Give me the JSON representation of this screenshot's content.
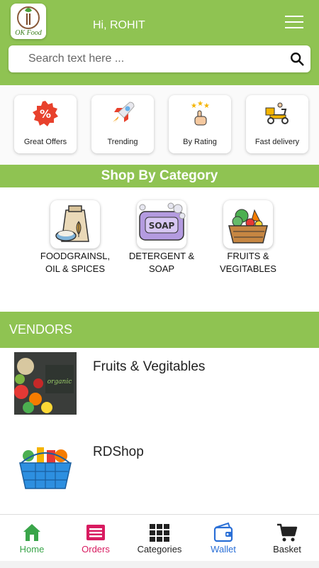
{
  "header": {
    "logo_text": "OK Food",
    "greeting": "Hi, ROHIT",
    "menu_icon": "hamburger-menu-icon"
  },
  "search": {
    "placeholder": "Search text here ...",
    "icon": "search-icon"
  },
  "quick_actions": [
    {
      "label": "Great Offers",
      "icon": "offer-percent-badge-icon"
    },
    {
      "label": "Trending",
      "icon": "rocket-icon"
    },
    {
      "label": "By Rating",
      "icon": "star-rating-hand-icon"
    },
    {
      "label": "Fast delivery",
      "icon": "delivery-scooter-icon"
    }
  ],
  "categories_section": {
    "title": "Shop By Category",
    "items": [
      {
        "label_line1": "FOODGRAINSL,",
        "label_line2": "OIL & SPICES",
        "icon": "grain-sack-icon"
      },
      {
        "label_line1": "DETERGENT &",
        "label_line2": "SOAP",
        "icon": "soap-bar-icon"
      },
      {
        "label_line1": "FRUITS &",
        "label_line2": "VEGITABLES",
        "icon": "vegetable-basket-icon"
      }
    ]
  },
  "vendors_section": {
    "title": "VENDORS",
    "items": [
      {
        "name": "Fruits & Vegitables",
        "image": "organic-vegetables-image"
      },
      {
        "name": "RDShop",
        "image": "grocery-basket-image"
      }
    ]
  },
  "bottom_nav": [
    {
      "label": "Home",
      "icon": "home-icon",
      "color": "#3aa54a"
    },
    {
      "label": "Orders",
      "icon": "orders-list-icon",
      "color": "#d81b60"
    },
    {
      "label": "Categories",
      "icon": "grid-icon",
      "color": "#222222"
    },
    {
      "label": "Wallet",
      "icon": "wallet-icon",
      "color": "#2a6fd6"
    },
    {
      "label": "Basket",
      "icon": "cart-icon",
      "color": "#222222"
    }
  ],
  "colors": {
    "brand_green": "#8fc352",
    "offer_red": "#e8412c"
  }
}
